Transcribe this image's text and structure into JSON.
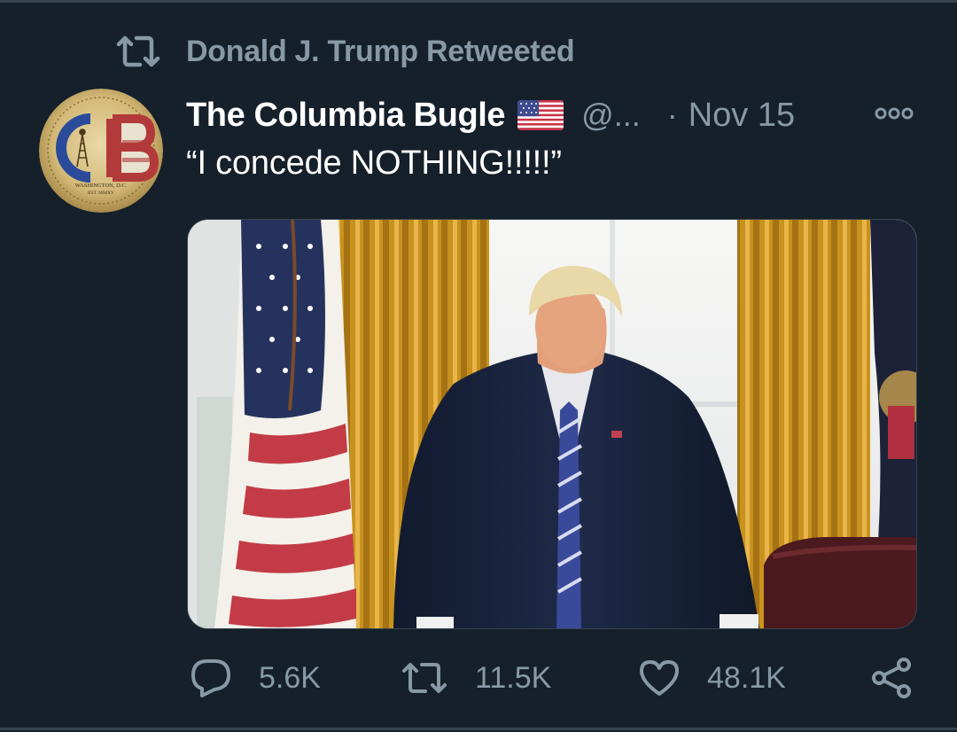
{
  "retweet_context": {
    "text": "Donald J. Trump Retweeted",
    "icon": "retweet-icon"
  },
  "tweet": {
    "display_name": "The Columbia Bugle",
    "flag_icon": "us-flag-emoji",
    "handle": "@...",
    "separator": "·",
    "time": "Nov 15",
    "text": "“I concede NOTHING!!!!!”",
    "avatar_text": {
      "monogram": "CB",
      "line1": "WASHINGTON, D.C.",
      "line2": "EST. MMXV"
    },
    "more_icon": "more-options-icon",
    "media_alt": "photo"
  },
  "actions": {
    "reply": {
      "icon": "reply-icon",
      "count": "5.6K"
    },
    "retweet": {
      "icon": "retweet-icon",
      "count": "11.5K"
    },
    "like": {
      "icon": "heart-icon",
      "count": "48.1K"
    },
    "share": {
      "icon": "share-icon"
    }
  },
  "colors": {
    "background": "#15202b",
    "primary_text": "#ffffff",
    "secondary_text": "#8899a6",
    "border": "#38444d"
  }
}
